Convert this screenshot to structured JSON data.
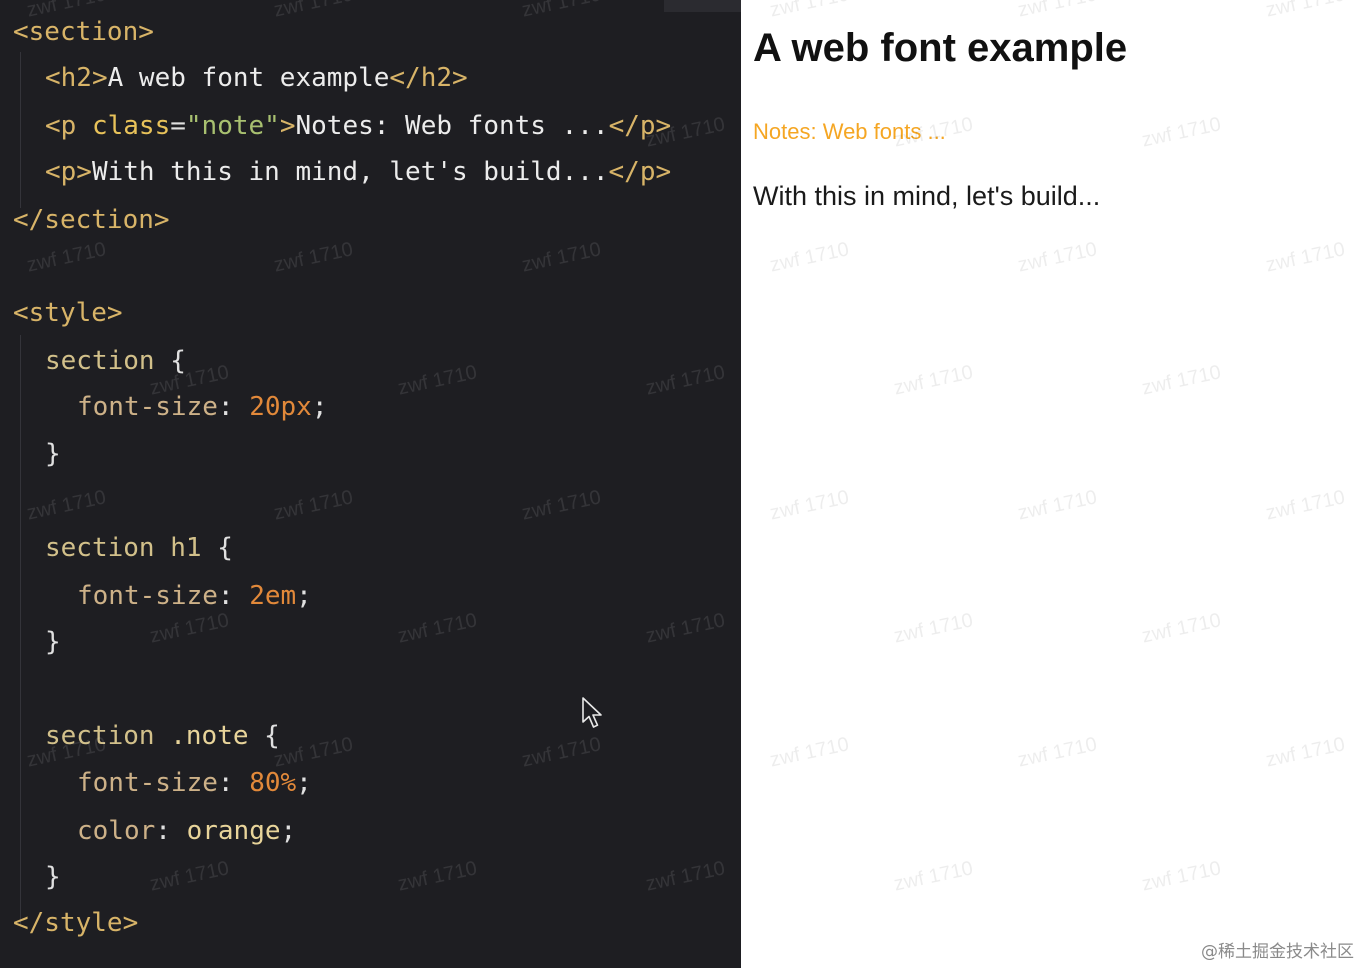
{
  "editor": {
    "lines": [
      {
        "parts": [
          {
            "c": "tag",
            "t": "<section>"
          }
        ]
      },
      {
        "parts": [
          {
            "c": "tag",
            "t": "<h2>"
          },
          {
            "c": "txt",
            "t": "A web font example"
          },
          {
            "c": "tag",
            "t": "</h2>"
          }
        ]
      },
      {
        "parts": [
          {
            "c": "tag",
            "t": "<p "
          },
          {
            "c": "attr",
            "t": "class"
          },
          {
            "c": "punc",
            "t": "="
          },
          {
            "c": "str",
            "t": "\"note\""
          },
          {
            "c": "tag",
            "t": ">"
          },
          {
            "c": "txt",
            "t": "Notes: Web fonts ..."
          },
          {
            "c": "tag",
            "t": "</p>"
          }
        ]
      },
      {
        "parts": [
          {
            "c": "tag",
            "t": "<p>"
          },
          {
            "c": "txt",
            "t": "With this in mind, let's build..."
          },
          {
            "c": "tag",
            "t": "</p>"
          }
        ]
      },
      {
        "parts": [
          {
            "c": "tag",
            "t": "</section>"
          }
        ]
      },
      {
        "parts": [
          {
            "c": "tag",
            "t": "<style>"
          }
        ]
      },
      {
        "parts": [
          {
            "c": "sel",
            "t": "section "
          },
          {
            "c": "punc",
            "t": "{"
          }
        ]
      },
      {
        "parts": [
          {
            "c": "prop",
            "t": "font-size"
          },
          {
            "c": "punc",
            "t": ": "
          },
          {
            "c": "num",
            "t": "20px"
          },
          {
            "c": "punc",
            "t": ";"
          }
        ]
      },
      {
        "parts": [
          {
            "c": "punc",
            "t": "}"
          }
        ]
      },
      {
        "parts": [
          {
            "c": "sel",
            "t": "section h1 "
          },
          {
            "c": "punc",
            "t": "{"
          }
        ]
      },
      {
        "parts": [
          {
            "c": "prop",
            "t": "font-size"
          },
          {
            "c": "punc",
            "t": ": "
          },
          {
            "c": "num",
            "t": "2em"
          },
          {
            "c": "punc",
            "t": ";"
          }
        ]
      },
      {
        "parts": [
          {
            "c": "punc",
            "t": "}"
          }
        ]
      },
      {
        "parts": [
          {
            "c": "sel",
            "t": "section "
          },
          {
            "c": "kw",
            "t": ".note"
          },
          {
            "c": "punc",
            "t": " {"
          }
        ]
      },
      {
        "parts": [
          {
            "c": "prop",
            "t": "font-size"
          },
          {
            "c": "punc",
            "t": ": "
          },
          {
            "c": "num",
            "t": "80%"
          },
          {
            "c": "punc",
            "t": ";"
          }
        ]
      },
      {
        "parts": [
          {
            "c": "prop",
            "t": "color"
          },
          {
            "c": "punc",
            "t": ": "
          },
          {
            "c": "kw",
            "t": "orange"
          },
          {
            "c": "punc",
            "t": ";"
          }
        ]
      },
      {
        "parts": [
          {
            "c": "punc",
            "t": "}"
          }
        ]
      },
      {
        "parts": [
          {
            "c": "tag",
            "t": "</style>"
          }
        ]
      }
    ]
  },
  "preview": {
    "title": "A web font example",
    "note": "Notes: Web fonts ...",
    "body": "With this in mind, let's build..."
  },
  "watermark": "zwf 1710",
  "credit": "@稀土掘金技术社区",
  "colors": {
    "editor_bg": "#1e1e22",
    "tag": "#d8b468",
    "number": "#e2893a",
    "note_orange": "#f5a623"
  },
  "icons": {
    "cursor": "mouse-pointer-icon"
  }
}
